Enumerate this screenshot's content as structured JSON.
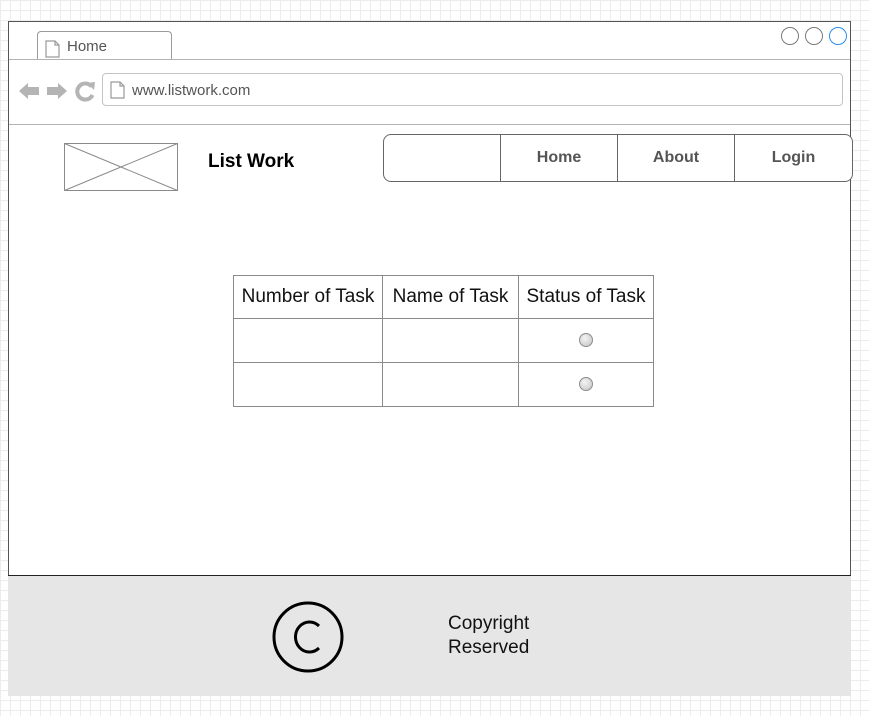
{
  "browser": {
    "tab_label": "Home",
    "url": "www.listwork.com",
    "colors": {
      "active_control": "#2d8ef0",
      "chrome_border": "#555555"
    }
  },
  "header": {
    "brand": "List Work",
    "nav": [
      "Home",
      "About",
      "Login"
    ]
  },
  "table": {
    "headers": [
      "Number of Task",
      "Name of Task",
      "Status of Task"
    ],
    "rows": [
      {
        "number": "",
        "name": "",
        "status_selected": false
      },
      {
        "number": "",
        "name": "",
        "status_selected": false
      }
    ]
  },
  "footer": {
    "icon": "copyright-icon",
    "line1": "Copyright",
    "line2": "Reserved",
    "background": "#e6e6e6"
  }
}
